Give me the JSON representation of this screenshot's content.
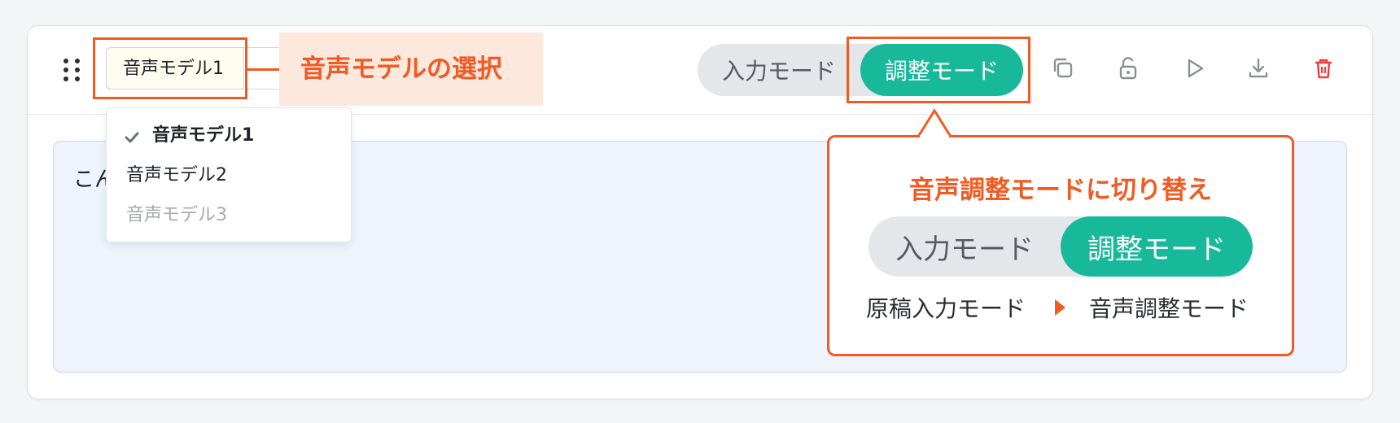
{
  "model_select": {
    "value": "音声モデル1",
    "options": [
      {
        "label": "音声モデル1",
        "selected": true,
        "disabled": false
      },
      {
        "label": "音声モデル2",
        "selected": false,
        "disabled": false
      },
      {
        "label": "音声モデル3",
        "selected": false,
        "disabled": true
      }
    ]
  },
  "annotations": {
    "model_select_label": "音声モデルの選択",
    "mode_switch_title": "音声調整モードに切り替え",
    "flow_from": "原稿入力モード",
    "flow_to": "音声調整モード"
  },
  "mode_toggle": {
    "input_label": "入力モード",
    "adjust_label": "調整モード",
    "active": "adjust"
  },
  "editor": {
    "text": "こん"
  },
  "icons": [
    "drag-handle-icon",
    "duplicate-icon",
    "unlock-icon",
    "play-icon",
    "download-icon",
    "trash-icon",
    "check-icon"
  ],
  "colors": {
    "accent": "#18b99b",
    "annotation": "#f15a22",
    "annotation_bg": "#fde8de",
    "danger": "#ef3b3b",
    "editor_bg": "#eef3fc"
  }
}
